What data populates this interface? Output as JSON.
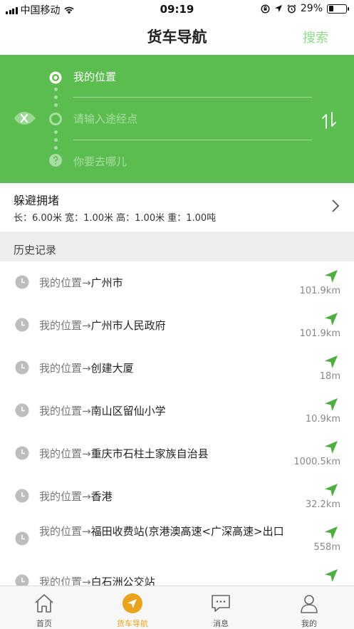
{
  "status_bar": {
    "carrier": "中国移动",
    "time": "09:19",
    "battery": "29%",
    "battery_level": 0.29
  },
  "header": {
    "title": "货车导航",
    "search_label": "搜索"
  },
  "route": {
    "origin": "我的位置",
    "waypoint_placeholder": "请输入途经点",
    "destination_placeholder": "你要去哪儿"
  },
  "avoid_congestion": {
    "title": "躲避拥堵",
    "specs": "长：6.00米  宽：1.00米  高：1.00米  重：1.00吨"
  },
  "history": {
    "title": "历史记录",
    "items": [
      {
        "from": "我的位置",
        "to": "广州市",
        "distance": "101.9km"
      },
      {
        "from": "我的位置",
        "to": "广州市人民政府",
        "distance": "101.9km"
      },
      {
        "from": "我的位置",
        "to": "创建大厦",
        "distance": "18m"
      },
      {
        "from": "我的位置",
        "to": "南山区留仙小学",
        "distance": "10.9km"
      },
      {
        "from": "我的位置",
        "to": "重庆市石柱土家族自治县",
        "distance": "1000.5km"
      },
      {
        "from": "我的位置",
        "to": "香港",
        "distance": "32.2km"
      },
      {
        "from": "我的位置",
        "to": "福田收费站(京港澳高速<广深高速>出口",
        "distance": "558m"
      },
      {
        "from": "我的位置",
        "to": "白石洲公交站",
        "distance": ""
      }
    ]
  },
  "tabs": [
    {
      "label": "首页",
      "icon": "home-icon"
    },
    {
      "label": "货车导航",
      "icon": "navigation-icon",
      "active": true
    },
    {
      "label": "消息",
      "icon": "message-icon"
    },
    {
      "label": "我的",
      "icon": "profile-icon"
    }
  ],
  "colors": {
    "brand_green": "#5bbd4f",
    "active_tab": "#e8a41c",
    "arrow_green": "#4caf3f"
  }
}
